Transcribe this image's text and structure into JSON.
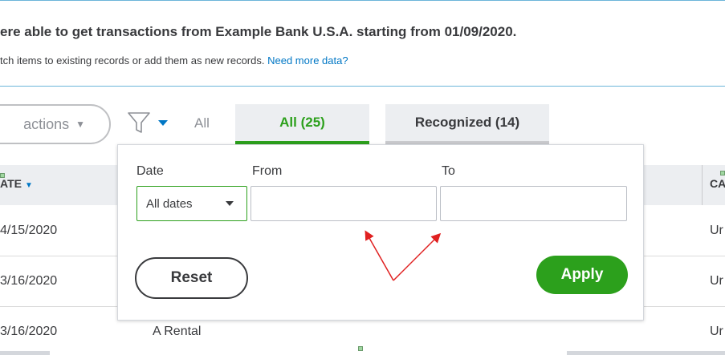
{
  "banner": {
    "heading": "ere able to get transactions from Example Bank U.S.A. starting from 01/09/2020.",
    "subtext": "tch items to existing records or add them as new records.",
    "link": "Need more data?"
  },
  "toolbar": {
    "actions_label": "actions",
    "all_link": "All",
    "icons": [
      "filter-icon",
      "chevron-down-icon"
    ]
  },
  "tabs": [
    {
      "label": "All (25)",
      "active": true
    },
    {
      "label": "Recognized (14)",
      "active": false
    }
  ],
  "table": {
    "headers": {
      "date": "ATE",
      "category": "CA"
    },
    "rows": [
      {
        "date": "4/15/2020",
        "description": "",
        "category": "Ur"
      },
      {
        "date": "3/16/2020",
        "description": "",
        "category": "Ur"
      },
      {
        "date": "3/16/2020",
        "description": "A Rental",
        "category": "Ur"
      }
    ]
  },
  "filter_popup": {
    "date_label": "Date",
    "from_label": "From",
    "to_label": "To",
    "date_selected": "All dates",
    "from_value": "",
    "to_value": "",
    "reset_label": "Reset",
    "apply_label": "Apply"
  },
  "colors": {
    "accent_green": "#2ca01c",
    "link_blue": "#0077c5",
    "annotation_red": "#e02020",
    "divider_blue": "#6cb5d9"
  }
}
